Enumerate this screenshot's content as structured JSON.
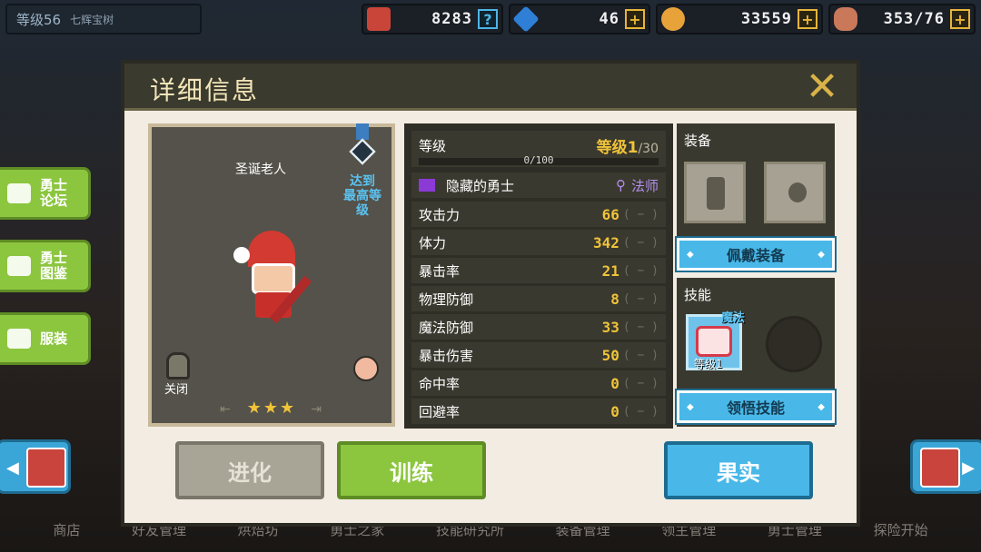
{
  "topbar": {
    "level": "等级56",
    "tree": "七辉宝树",
    "resources": [
      {
        "icon": "medal-star-icon",
        "value": "8283",
        "btn": "?"
      },
      {
        "icon": "diamond-icon",
        "value": "46",
        "btn": "+"
      },
      {
        "icon": "coin-icon",
        "value": "33559",
        "btn": "+"
      },
      {
        "icon": "meat-icon",
        "value": "353/76",
        "btn": "+"
      }
    ]
  },
  "side": {
    "forum": "勇士\n论坛",
    "codex": "勇士\n图鉴",
    "costume": "服装"
  },
  "bottom_nav": [
    "商店",
    "好友管理",
    "烘焙坊",
    "勇士之家",
    "技能研究所",
    "装备管理",
    "领主管理",
    "勇士管理",
    "探险开始"
  ],
  "dialog": {
    "title": "详细信息",
    "close": "✕",
    "hero": {
      "name": "圣诞老人",
      "max_level": "达到\n最高等\n级",
      "close_label": "关闭",
      "stars": "★★★"
    },
    "level": {
      "label": "等级",
      "value": "等级1",
      "max": "/30",
      "xp": "0/100",
      "xp_ratio": 0
    },
    "class_row": {
      "title": "隐藏的勇士",
      "class": "法师"
    },
    "stats": [
      {
        "label": "攻击力",
        "value": "66",
        "delta": "( − )"
      },
      {
        "label": "体力",
        "value": "342",
        "delta": "( − )"
      },
      {
        "label": "暴击率",
        "value": "21",
        "delta": "( − )"
      },
      {
        "label": "物理防御",
        "value": "8",
        "delta": "( − )"
      },
      {
        "label": "魔法防御",
        "value": "33",
        "delta": "( − )"
      },
      {
        "label": "暴击伤害",
        "value": "50",
        "delta": "( − )"
      },
      {
        "label": "命中率",
        "value": "0",
        "delta": "( − )"
      },
      {
        "label": "回避率",
        "value": "0",
        "delta": "( − )"
      }
    ],
    "equipment": {
      "title": "装备",
      "button": "佩戴装备"
    },
    "skills": {
      "title": "技能",
      "skill_tag": "魔法",
      "skill_level": "等级1",
      "button": "领悟技能"
    },
    "buttons": {
      "evolve": "进化",
      "train": "训练",
      "fruit": "果实"
    }
  },
  "colors": {
    "accent_green": "#8cc63f",
    "accent_blue": "#49b8e8",
    "stat_gold": "#f0c33a"
  }
}
